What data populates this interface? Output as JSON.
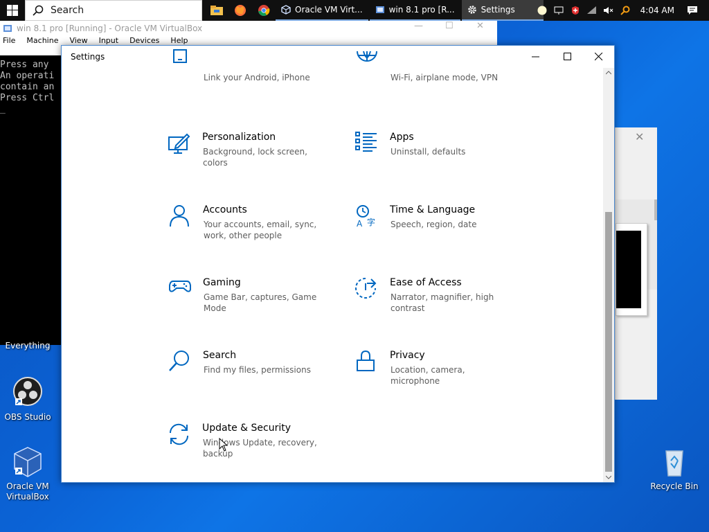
{
  "taskbar": {
    "search_placeholder": "Search",
    "tasks": [
      {
        "label": "Oracle VM Virt..."
      },
      {
        "label": "win 8.1 pro [R..."
      },
      {
        "label": "Settings"
      }
    ],
    "clock": "4:04 AM"
  },
  "vbox": {
    "title": "win 8.1 pro [Running] - Oracle VM VirtualBox",
    "menu": [
      "File",
      "Machine",
      "View",
      "Input",
      "Devices",
      "Help"
    ],
    "screen_lines": [
      "Press any",
      "An operati",
      "contain an",
      "Press Ctrl",
      "_"
    ]
  },
  "desktop": {
    "icons": [
      {
        "label": "Everything"
      },
      {
        "label": "OBS Studio"
      },
      {
        "label": "Oracle VM VirtualBox"
      },
      {
        "label": "Recycle Bin"
      }
    ]
  },
  "settings": {
    "title": "Settings",
    "tiles": [
      {
        "name": "",
        "desc": "Link your Android, iPhone",
        "icon": "phone-icon"
      },
      {
        "name": "",
        "desc": "Wi-Fi, airplane mode, VPN",
        "icon": "globe-icon"
      },
      {
        "name": "Personalization",
        "desc": "Background, lock screen, colors",
        "icon": "personalization-icon"
      },
      {
        "name": "Apps",
        "desc": "Uninstall, defaults",
        "icon": "apps-icon"
      },
      {
        "name": "Accounts",
        "desc": "Your accounts, email, sync, work, other people",
        "icon": "person-icon"
      },
      {
        "name": "Time & Language",
        "desc": "Speech, region, date",
        "icon": "time-language-icon"
      },
      {
        "name": "Gaming",
        "desc": "Game Bar, captures, Game Mode",
        "icon": "gamepad-icon"
      },
      {
        "name": "Ease of Access",
        "desc": "Narrator, magnifier, high contrast",
        "icon": "ease-of-access-icon"
      },
      {
        "name": "Search",
        "desc": "Find my files, permissions",
        "icon": "search-icon"
      },
      {
        "name": "Privacy",
        "desc": "Location, camera, microphone",
        "icon": "lock-icon"
      },
      {
        "name": "Update & Security",
        "desc": "Windows Update, recovery, backup",
        "icon": "update-icon"
      }
    ]
  },
  "colors": {
    "accent": "#0067c0",
    "taskbar": "#101010",
    "desktop": "#0b63d6"
  }
}
